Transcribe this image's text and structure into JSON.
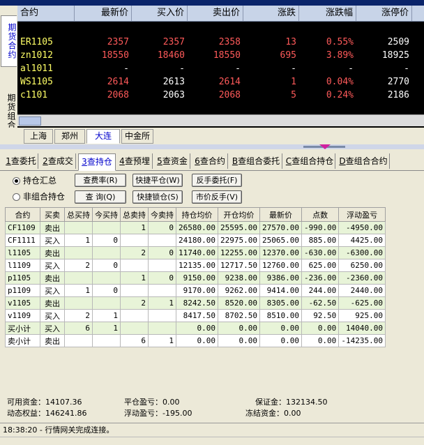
{
  "left_tabs": [
    "期货合约",
    "期货组合"
  ],
  "market": {
    "headers": [
      "合约",
      "最新价",
      "买入价",
      "卖出价",
      "涨跌",
      "涨跌幅",
      "涨停价"
    ],
    "rows": [
      {
        "contract": "ER1105",
        "last": "2357",
        "bid": "2357",
        "ask": "2358",
        "change": "13",
        "pct": "0.55%",
        "limit_up": "2509"
      },
      {
        "contract": "zn1012",
        "last": "18550",
        "bid": "18460",
        "ask": "18550",
        "change": "695",
        "pct": "3.89%",
        "limit_up": "18925"
      },
      {
        "contract": "al1011",
        "last": "-",
        "bid": "-",
        "ask": "-",
        "change": "-",
        "pct": "-",
        "limit_up": "-"
      },
      {
        "contract": "WS1105",
        "last": "2614",
        "bid": "2613",
        "ask": "2614",
        "change": "1",
        "pct": "0.04%",
        "limit_up": "2770"
      },
      {
        "contract": "c1101",
        "last": "2068",
        "bid": "2063",
        "ask": "2068",
        "change": "5",
        "pct": "0.24%",
        "limit_up": "2186"
      }
    ]
  },
  "exchanges": [
    "上海",
    "郑州",
    "大连",
    "中金所"
  ],
  "function_tabs": [
    {
      "key": "1",
      "label": "查委托"
    },
    {
      "key": "2",
      "label": "查成交"
    },
    {
      "key": "3",
      "label": "查持仓"
    },
    {
      "key": "4",
      "label": "查预埋"
    },
    {
      "key": "5",
      "label": "查资金"
    },
    {
      "key": "6",
      "label": "查合约"
    },
    {
      "key": "B",
      "label": "查组合委托"
    },
    {
      "key": "C",
      "label": "查组合持仓"
    },
    {
      "key": "D",
      "label": "查组合合约"
    }
  ],
  "radios": [
    "持仓汇总",
    "非组合持仓"
  ],
  "buttons": {
    "fee": "查费率(R)",
    "query": "查 询(Q)",
    "quick_close": "快捷平仓(W)",
    "quick_lock": "快捷锁仓(S)",
    "reverse": "反手委托(F)",
    "market_reverse": "市价反手(V)"
  },
  "table": {
    "headers": [
      "合约",
      "买卖",
      "总买持",
      "今买持",
      "总卖持",
      "今卖持",
      "持仓均价",
      "开仓均价",
      "最新价",
      "点数",
      "浮动盈亏"
    ],
    "rows": [
      [
        "CF1109",
        "卖出",
        "",
        "",
        "1",
        "0",
        "26580.00",
        "25595.00",
        "27570.00",
        "-990.00",
        "-4950.00"
      ],
      [
        "CF1111",
        "买入",
        "1",
        "0",
        "",
        "",
        "24180.00",
        "22975.00",
        "25065.00",
        "885.00",
        "4425.00"
      ],
      [
        "l1105",
        "卖出",
        "",
        "",
        "2",
        "0",
        "11740.00",
        "12255.00",
        "12370.00",
        "-630.00",
        "-6300.00"
      ],
      [
        "l1109",
        "买入",
        "2",
        "0",
        "",
        "",
        "12135.00",
        "12717.50",
        "12760.00",
        "625.00",
        "6250.00"
      ],
      [
        "p1105",
        "卖出",
        "",
        "",
        "1",
        "0",
        "9150.00",
        "9238.00",
        "9386.00",
        "-236.00",
        "-2360.00"
      ],
      [
        "p1109",
        "买入",
        "1",
        "0",
        "",
        "",
        "9170.00",
        "9262.00",
        "9414.00",
        "244.00",
        "2440.00"
      ],
      [
        "v1105",
        "卖出",
        "",
        "",
        "2",
        "1",
        "8242.50",
        "8520.00",
        "8305.00",
        "-62.50",
        "-625.00"
      ],
      [
        "v1109",
        "买入",
        "2",
        "1",
        "",
        "",
        "8417.50",
        "8702.50",
        "8510.00",
        "92.50",
        "925.00"
      ],
      [
        "买小计",
        "买入",
        "6",
        "1",
        "",
        "",
        "0.00",
        "0.00",
        "0.00",
        "0.00",
        "14040.00"
      ],
      [
        "卖小计",
        "卖出",
        "",
        "",
        "6",
        "1",
        "0.00",
        "0.00",
        "0.00",
        "0.00",
        "-14235.00"
      ]
    ]
  },
  "summary": {
    "available": "可用资金：14107.36",
    "close_pl": "平仓盈亏：0.00",
    "margin": "保证金：132134.50",
    "equity": "动态权益：146241.86",
    "float_pl": "浮动盈亏：-195.00",
    "frozen": "冻结资金：0.00"
  },
  "status": "18:38:20 - 行情网关完成连接。",
  "colors": {
    "market_bg": "#000000",
    "up": "#ff5a5a",
    "active_tab": "#0000cc",
    "row_green": "#e8f4d8"
  }
}
